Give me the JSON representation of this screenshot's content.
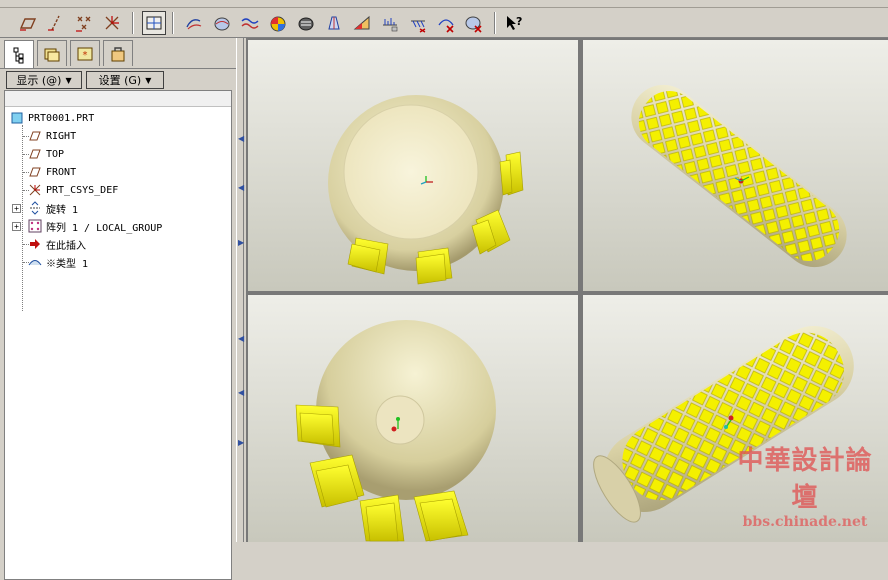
{
  "toolbar": {
    "buttons": [
      {
        "name": "datum-plane-icon"
      },
      {
        "name": "datum-axis-icon"
      },
      {
        "name": "datum-point-icon"
      },
      {
        "name": "csys-icon"
      },
      {
        "name": "view-toggle-icon"
      },
      {
        "name": "sketch-tool-icon"
      },
      {
        "name": "surface-analysis-icon"
      },
      {
        "name": "curvature-icon"
      },
      {
        "name": "shade-analysis-icon"
      },
      {
        "name": "reflection-icon"
      },
      {
        "name": "draft-icon"
      },
      {
        "name": "slope-icon"
      },
      {
        "name": "deviation-icon"
      },
      {
        "name": "offset-icon"
      },
      {
        "name": "delete-analysis-icon"
      },
      {
        "name": "clear-analysis-icon"
      },
      {
        "name": "whats-this-icon"
      }
    ],
    "whats_this": "?"
  },
  "panel": {
    "show_menu": "显示 (@)",
    "settings_menu": "设置 (G)"
  },
  "tree": {
    "root": "PRT0001.PRT",
    "items": [
      {
        "label": "RIGHT",
        "icon": "datum-plane-icon",
        "expandable": false
      },
      {
        "label": "TOP",
        "icon": "datum-plane-icon",
        "expandable": false
      },
      {
        "label": "FRONT",
        "icon": "datum-plane-icon",
        "expandable": false
      },
      {
        "label": "PRT_CSYS_DEF",
        "icon": "csys-icon",
        "expandable": false
      },
      {
        "label": "旋转 1",
        "icon": "revolve-icon",
        "expandable": true
      },
      {
        "label": "阵列 1 / LOCAL_GROUP",
        "icon": "pattern-icon",
        "expandable": true
      },
      {
        "label": "在此插入",
        "icon": "insert-here-icon",
        "expandable": false
      },
      {
        "label": "※类型 1",
        "icon": "surface-icon",
        "expandable": false
      }
    ]
  },
  "watermark": {
    "title": "中華設計論壇",
    "url": "bbs.chinade.net"
  },
  "colors": {
    "part_body": "#e8e2b8",
    "part_accent": "#f0f000",
    "viewport_bg_top": "#eeeee8",
    "viewport_bg_bottom": "#c8c8bc"
  }
}
